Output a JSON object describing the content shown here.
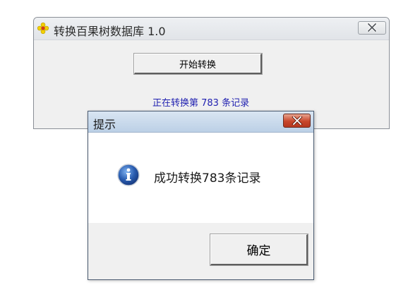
{
  "main_window": {
    "title": "转换百果树数据库 1.0",
    "start_button_label": "开始转换",
    "status_text": "正在转换第 783 条记录",
    "icons": {
      "app": "app-flower-icon",
      "close": "close-icon"
    }
  },
  "dialog": {
    "title": "提示",
    "message": "成功转换783条记录",
    "ok_button_label": "确定",
    "icons": {
      "info": "info-icon",
      "close": "close-icon"
    },
    "colors": {
      "close_button": "#c8462b",
      "info_icon": "#2a5db0",
      "titlebar": "#c9d9ec"
    }
  }
}
